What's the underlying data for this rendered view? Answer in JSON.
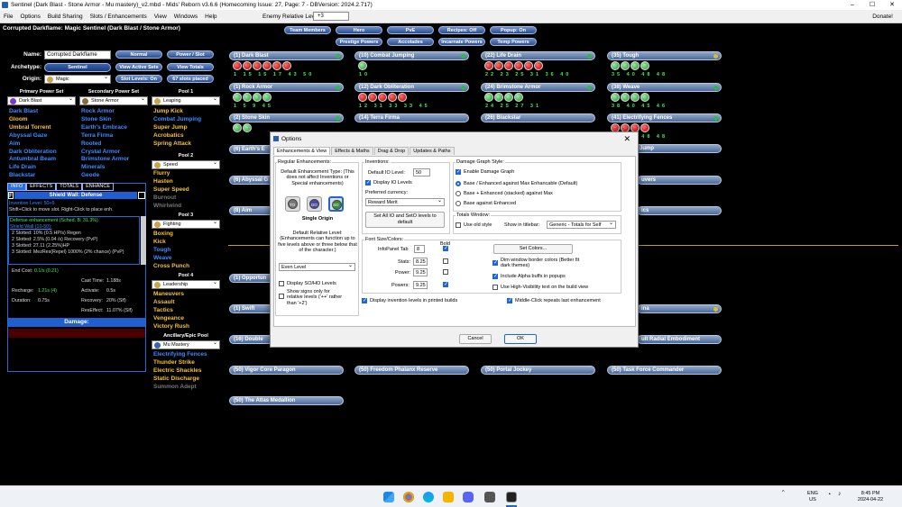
{
  "window": {
    "title": "Sentinel (Dark Blast - Stone Armor - Mu mastery)_v2.mbd - Mids' Reborn v3.6.6 (Homecoming Issue: 27, Page: 7 - DBVersion: 2024.2.717)",
    "controls": [
      "–",
      "☐",
      "✕"
    ]
  },
  "menu": {
    "items": [
      "File",
      "Options",
      "Build Sharing",
      "Slots / Enhancements",
      "View",
      "Windows",
      "Help"
    ],
    "enemy_level_label": "Enemy Relative Level:",
    "enemy_level_value": "+3",
    "donate": "Donate!"
  },
  "header": {
    "build_name": "Corrupted Darkflame: Magic Sentinel (Dark Blast / Stone Armor)"
  },
  "top_buttons": {
    "row1": [
      "Team Members",
      "Hero",
      "PvE",
      "Recipes: Off",
      "Popup: On"
    ],
    "row2": [
      "Prestige Powers",
      "Accolades",
      "Incarnate Powers",
      "Temp Powers"
    ]
  },
  "char": {
    "name_label": "Name:",
    "name_value": "Corrupted Darkflame",
    "archetype_label": "Archetype:",
    "archetype_value": "Sentinel",
    "origin_label": "Origin:",
    "origin_value": "Magic",
    "btn_normal": "Normal",
    "btn_power_slot": "Power / Slot",
    "btn_active_sets": "View Active Sets",
    "btn_view_totals": "View Totals",
    "btn_slot_levels": "Slot Levels: On",
    "btn_slots_placed": "67 slots placed"
  },
  "primary": {
    "header": "Primary Power Set",
    "value": "Dark Blast",
    "powers": [
      "Dark Blast",
      "Gloom",
      "Umbral Torrent",
      "Abyssal Gaze",
      "Aim",
      "Dark Obliteration",
      "Antumbral Beam",
      "Life Drain",
      "Blackstar"
    ]
  },
  "secondary": {
    "header": "Secondary Power Set",
    "value": "Stone Armor",
    "powers": [
      "Rock Armor",
      "Stone Skin",
      "Earth's Embrace",
      "Terra Firma",
      "Rooted",
      "Crystal Armor",
      "Brimstone Armor",
      "Minerals",
      "Geode"
    ]
  },
  "pools": [
    {
      "header": "Pool 1",
      "value": "Leaping",
      "powers": [
        "Jump Kick",
        "Combat Jumping",
        "Super Jump",
        "Acrobatics",
        "Spring Attack"
      ]
    },
    {
      "header": "Pool 2",
      "value": "Speed",
      "powers": [
        "Flurry",
        "Hasten",
        "Super Speed",
        "Burnout",
        "Whirlwind"
      ]
    },
    {
      "header": "Pool 3",
      "value": "Fighting",
      "powers": [
        "Boxing",
        "Kick",
        "Tough",
        "Weave",
        "Cross Punch"
      ]
    },
    {
      "header": "Pool 4",
      "value": "Leadership",
      "powers": [
        "Maneuvers",
        "Assault",
        "Tactics",
        "Vengeance",
        "Victory Rush"
      ]
    },
    {
      "header": "Ancillary/Epic Pool",
      "value": "Mu Mastery",
      "powers": [
        "Electrifying Fences",
        "Thunder Strike",
        "Electric Shackles",
        "Static Discharge",
        "Summon Adept"
      ]
    }
  ],
  "info": {
    "tabs": [
      "INFO",
      "EFFECTS",
      "TOTALS",
      "ENHANCE"
    ],
    "corner": "F",
    "power_title": "Shield Wall: Defense",
    "level_line": "Invention Level: 50+5",
    "hint": "Shift+Click to move slot. Right-Click to place enh.",
    "enh_title": "Defense enhancement (Sched. B: 31.3%)",
    "set_name": "Shield Wall (10-50):",
    "bonuses": [
      "2 Slotted: 10% (0.5 HP/s) Regen",
      "2 Slotted: 2.5% (0.04 /s) Recovery (PvP)",
      "3 Slotted: 27.11 (2.25%)HP",
      "3 Slotted: MezRes(Repel) 1000% (2% chance) (PvP)"
    ],
    "end_cost_label": "End Cost:",
    "end_cost_value": "0.1/s (0.21)",
    "cast_time_label": "Cast Time:",
    "cast_time_value": "1.188s",
    "recharge_label": "Recharge:",
    "recharge_value": "1.21s (4)",
    "activate_label": "Activate:",
    "activate_value": "0.5s",
    "duration_label": "Duration:",
    "duration_value": "0.75s",
    "recovery_label": "Recovery:",
    "recovery_value": "20% (Slf)",
    "resEffect_label": "ResEffect:",
    "resEffect_value": "11.07% (Slf)",
    "damage_header": "Damage:"
  },
  "powers_col1": [
    "(1) Dark Blast",
    "(1) Rock Armor",
    "(2) Stone Skin",
    "(6) Earth's E",
    "(6) Abyssal G",
    "(8) Aim",
    "(1) Opportun",
    "(1) Swift",
    "(16) Double",
    "(50) Vigor Core Paragon",
    "(50) The Atlas Medallion"
  ],
  "slot_nums_col1": {
    "darkblast": "1 15 15 17 43 50",
    "rockarmor": "1 5 9 45"
  },
  "powers_col2": [
    "(10) Combat Jumping",
    "(12) Dark Obliteration",
    "(14) Terra Firma",
    "(50) Freedom Phalanx Reserve"
  ],
  "slot_nums_col2": {
    "combat": "10",
    "darkoblit": "12 31 33 33 45"
  },
  "powers_col3": [
    "(22) Life Drain",
    "(24) Brimstone Armor",
    "(26) Blackstar",
    "(50) Portal Jockey"
  ],
  "slot_nums_col3": {
    "lifedrain": "22 23 25 31 36 40",
    "brimstone": "24 25 27 31"
  },
  "powers_col4": [
    "(35) Tough",
    "(38) Weave",
    "(41) Electrifying Fences",
    "(44) Super Jump",
    "uvers",
    "ics",
    "ina",
    "ult Radial Embodiment",
    "(50) Task Force Commander"
  ],
  "slot_nums_col4": {
    "tough": "35 40 48 48",
    "weave": "38 40 45 46",
    "fences": "41 43 48 48"
  },
  "dialog": {
    "title": "Options",
    "close": "✕",
    "tabs": [
      "Enhancements & View",
      "Effects & Maths",
      "Drag & Drop",
      "Updates & Paths"
    ],
    "reg_header": "Regular Enhancements:",
    "reg_desc": "Default Enhancement Type: (This does not affect Inventions or Special enhancements)",
    "icon_labels": [
      "TO",
      "DO",
      "SO"
    ],
    "single_origin": "Single Origin",
    "rel_desc": "Default Relative Level: (Enhancements can function up to five levels above or three below that of the character.)",
    "rel_value": "Even Level",
    "display_sohos": "Display SO/HO Levels",
    "show_signs": "Show signs only for relative levels ('++' rather than '+2')",
    "inv_header": "Inventions:",
    "default_io_label": "Default IO Level:",
    "default_io_value": "50",
    "display_io": "Display IO Levels",
    "pref_currency": "Preferred currency:",
    "currency_value": "Reward Merit",
    "set_all_btn": "Set All IO and SetO levels to default",
    "graph_header": "Damage Graph Style:",
    "enable_graph": "Enable Damage Graph",
    "radio1": "Base / Enhanced against Max Enhancable (Default)",
    "radio2": "Base + Enhanced (stacked) against Max",
    "radio3": "Base against Enhanced",
    "totals_header": "Totals Window:",
    "old_style": "Use old style",
    "show_titlebar": "Show in titlebar:",
    "titlebar_value": "Generic - Totals for Self",
    "font_header": "Font Size/Colors:",
    "bold": "Bold",
    "infopanel_label": "InfoPanel Tab",
    "infopanel_value": "8",
    "stats_label": "Stats:",
    "stats_value": "8.25",
    "power_label": "Power:",
    "power_value": "9.25",
    "powers_label": "Powers:",
    "powers_value": "9.25",
    "set_colors": "Set Colors...",
    "dim_border": "Dim window border colors (Better fit dark themes)",
    "include_alpha": "Include Alpha buffs in popups",
    "high_vis": "Use High-Visibility text on the build view",
    "display_inv_print": "Display invention levels in printed builds",
    "middle_click": "Middle-Click repeats last enhancement",
    "cancel": "Cancel",
    "ok": "OK"
  },
  "taskbar": {
    "lang1": "ENG",
    "lang2": "US",
    "time": "8:45 PM",
    "date": "2024-04-22"
  },
  "colors": {
    "accent": "#1e66d6",
    "power_blue": "#3d8bff",
    "pool_yellow": "#f4c430",
    "slot_red": "#b30000",
    "slot_green": "#2a8b36"
  }
}
